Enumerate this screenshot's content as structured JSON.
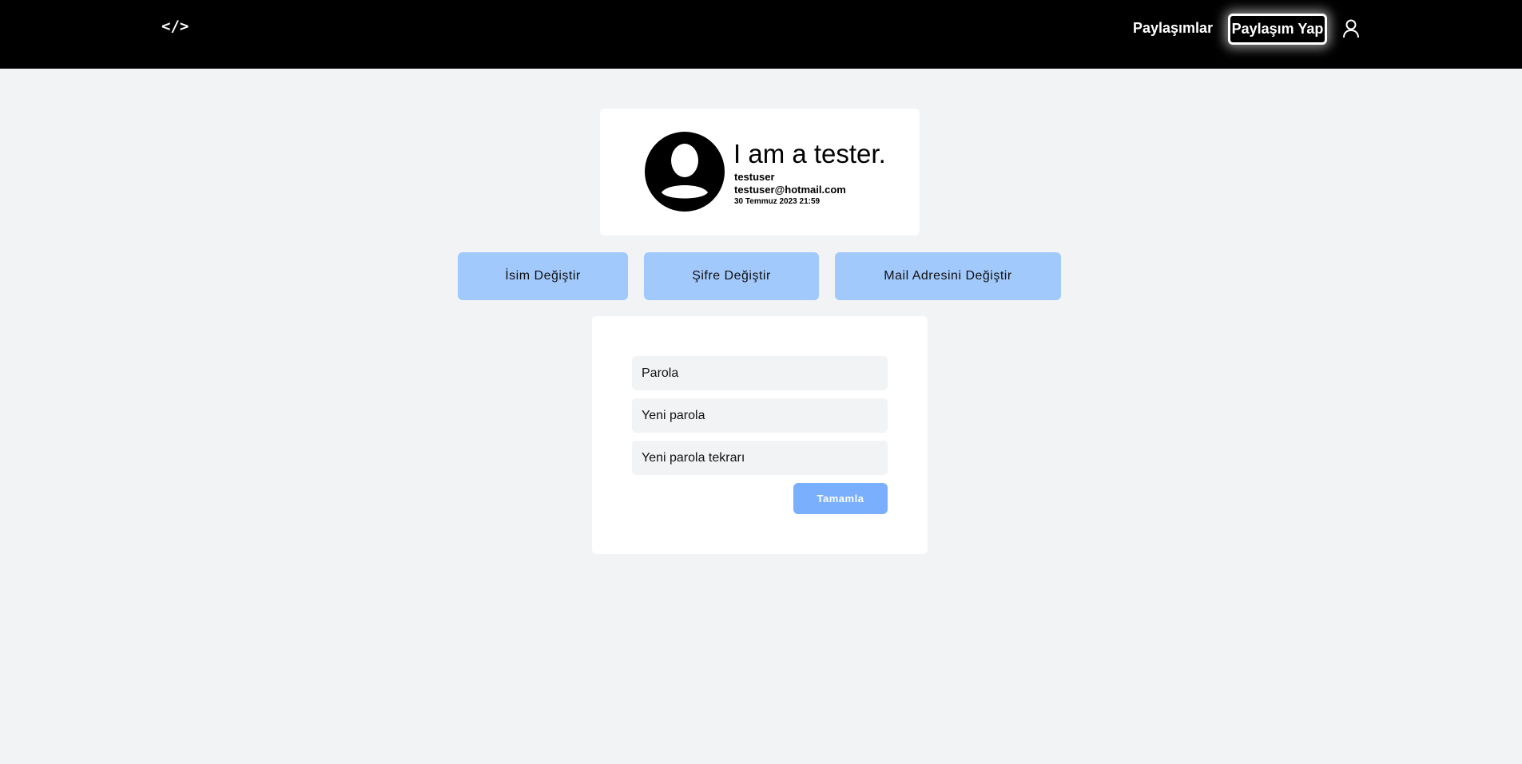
{
  "header": {
    "logo": "</>",
    "nav_posts": "Paylaşımlar",
    "nav_create": "Paylaşım Yap"
  },
  "profile": {
    "bio": "I am a tester.",
    "username": "testuser",
    "email": "testuser@hotmail.com",
    "date": "30 Temmuz 2023 21:59"
  },
  "tabs": [
    {
      "label": "İsim Değiştir"
    },
    {
      "label": "Şifre Değiştir"
    },
    {
      "label": "Mail Adresini Değiştir"
    }
  ],
  "form": {
    "password_placeholder": "Parola",
    "new_password_placeholder": "Yeni parola",
    "repeat_placeholder": "Yeni parola tekrarı",
    "submit": "Tamamla"
  }
}
